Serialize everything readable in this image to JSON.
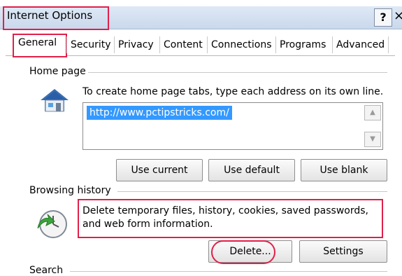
{
  "window": {
    "title": "Internet Options",
    "help_label": "?",
    "close_label": "×"
  },
  "tabs": [
    "General",
    "Security",
    "Privacy",
    "Content",
    "Connections",
    "Programs",
    "Advanced"
  ],
  "home_page": {
    "group_label": "Home page",
    "description": "To create home page tabs, type each address on its own line.",
    "url": "http://www.pctipstricks.com/",
    "buttons": {
      "use_current": "Use current",
      "use_default": "Use default",
      "use_blank": "Use blank"
    }
  },
  "browsing_history": {
    "group_label": "Browsing history",
    "description_line1": "Delete temporary files, history, cookies, saved passwords,",
    "description_line2": "and web form information.",
    "buttons": {
      "delete": "Delete...",
      "settings": "Settings"
    }
  },
  "search": {
    "group_label": "Search"
  },
  "colors": {
    "highlight": "#e0204a",
    "selection": "#3399ff"
  }
}
